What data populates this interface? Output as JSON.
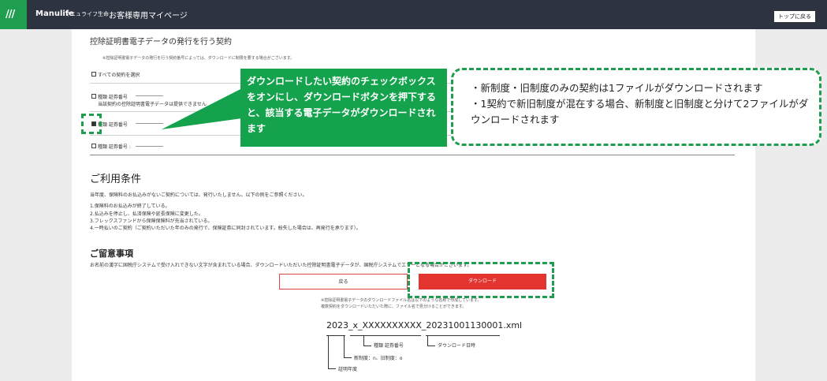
{
  "header": {
    "brand": "Manulife",
    "brand_jp": "マニュライフ生命",
    "title": "お客様専用マイページ",
    "top_button": "トップに戻る"
  },
  "contract_section": {
    "title": "控除証明書電子データの発行を行う契約",
    "note": "※控除証明書電子データの発行を行う契約番号によっては、ダウンロードに制限を要する場合がございます。",
    "select_all": "すべての契約を選択",
    "items": [
      {
        "label": "種類 証券番号",
        "sub": "当該契約の控除証明書電子データは提供できません",
        "checked": false
      },
      {
        "label": "種類 証券番号",
        "checked": true
      },
      {
        "label": "種類 証券番号 :",
        "checked": false
      }
    ]
  },
  "callout_green": "ダウンロードしたい契約のチェックボックスをオンにし、ダウンロードボタンを押下すると、該当する電子データがダウンロードされます",
  "callout_info": [
    "・新制度・旧制度のみの契約は1ファイルがダウンロードされます",
    "・1契約で新旧制度が混在する場合、新制度と旧制度と分けて2ファイルがダウンロードされます"
  ],
  "terms": {
    "title": "ご利用条件",
    "intro": "当年度、保険料のお払込みがないご契約については、発行いたしません。以下の例をご参照ください。",
    "items": [
      "1.保険料のお払込みが終了している。",
      "2.払込みを停止し、払済保険や延長保険に変更した。",
      "3.フレックスファンドから保険保険料が充当されている。",
      "4.一時払いのご契約（ご契約いただいた年のみの発行で、保険証券に同封されています。紛失した場合は、再発行を承ります）。"
    ]
  },
  "notice": {
    "title": "ご留意事項",
    "text": "お名前の漢字に国税庁システムで受け入れできない文字が含まれている場合、ダウンロードいただいた控除証明書電子データが、国税庁システムでエラーとなる場合がございます。"
  },
  "buttons": {
    "back": "戻る",
    "download": "ダウンロード"
  },
  "file_note": [
    "※控除証明書電子データのダウンロードファイル名は以下のような名称で作成しています。",
    "複数契約をダウンロードいただいた際に、ファイル名で見分けることができます。"
  ],
  "filename": "2023_x_XXXXXXXXXX_20231001130001.xml",
  "filename_parts": {
    "type_policy": "種類 証券番号",
    "download_datetime": "ダウンロード日時",
    "system": "新制度：n、旧制度：o",
    "year": "証明年度"
  }
}
